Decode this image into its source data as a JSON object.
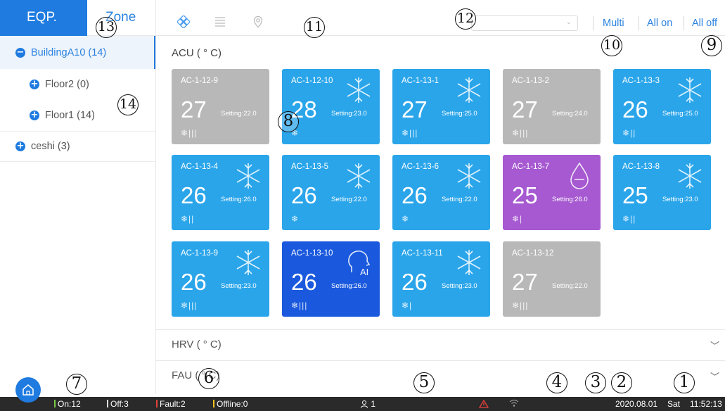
{
  "sidebar": {
    "tab_eqp": "EQP.",
    "tab_zone": "Zone",
    "tree": [
      {
        "label": "BuildingA10 (14)",
        "icon": "minus",
        "selected": true
      },
      {
        "label": "Floor2 (0)",
        "icon": "plus"
      },
      {
        "label": "Floor1 (14)",
        "icon": "plus"
      },
      {
        "label": "ceshi (3)",
        "icon": "plus"
      }
    ]
  },
  "toolbar": {
    "icons": [
      "grid-view-icon",
      "list-view-icon",
      "location-icon"
    ],
    "dropdown_value": "",
    "multi": "Multi",
    "all_on": "All on",
    "all_off": "All off"
  },
  "sections": {
    "acu": "ACU ( ° C)",
    "hrv": "HRV ( ° C)",
    "fau": "FAU ( ° C)"
  },
  "cards": [
    {
      "name": "AC-1-12-9",
      "temp": "27",
      "setting": "Setting:22.0",
      "fan": "❄|||",
      "color": "#b8b8b8",
      "mode": "none"
    },
    {
      "name": "AC-1-12-10",
      "temp": "28",
      "setting": "Setting:23.0",
      "fan": "❄",
      "color": "#2aa5ea",
      "mode": "snowflake"
    },
    {
      "name": "AC-1-13-1",
      "temp": "27",
      "setting": "Setting:25.0",
      "fan": "❄|||",
      "color": "#2aa5ea",
      "mode": "snowflake"
    },
    {
      "name": "AC-1-13-2",
      "temp": "27",
      "setting": "Setting:24.0",
      "fan": "❄|||",
      "color": "#b8b8b8",
      "mode": "none"
    },
    {
      "name": "AC-1-13-3",
      "temp": "26",
      "setting": "Setting:25.0",
      "fan": "❄||",
      "color": "#2aa5ea",
      "mode": "snowflake"
    },
    {
      "name": "AC-1-13-4",
      "temp": "26",
      "setting": "Setting:26.0",
      "fan": "❄||",
      "color": "#2aa5ea",
      "mode": "snowflake"
    },
    {
      "name": "AC-1-13-5",
      "temp": "26",
      "setting": "Setting:22.0",
      "fan": "❄",
      "color": "#2aa5ea",
      "mode": "snowflake"
    },
    {
      "name": "AC-1-13-6",
      "temp": "26",
      "setting": "Setting:22.0",
      "fan": "❄",
      "color": "#2aa5ea",
      "mode": "snowflake"
    },
    {
      "name": "AC-1-13-7",
      "temp": "25",
      "setting": "Setting:26.0",
      "fan": "❄|",
      "color": "#a659d0",
      "mode": "drop"
    },
    {
      "name": "AC-1-13-8",
      "temp": "25",
      "setting": "Setting:23.0",
      "fan": "❄||",
      "color": "#2aa5ea",
      "mode": "snowflake"
    },
    {
      "name": "AC-1-13-9",
      "temp": "26",
      "setting": "Setting:23.0",
      "fan": "❄|||",
      "color": "#2aa5ea",
      "mode": "snowflake"
    },
    {
      "name": "AC-1-13-10",
      "temp": "26",
      "setting": "Setting:26.0",
      "fan": "❄|||",
      "color": "#1a59dd",
      "mode": "ai"
    },
    {
      "name": "AC-1-13-11",
      "temp": "26",
      "setting": "Setting:23.0",
      "fan": "❄|",
      "color": "#2aa5ea",
      "mode": "snowflake"
    },
    {
      "name": "AC-1-13-12",
      "temp": "27",
      "setting": "Setting:22.0",
      "fan": "❄|||",
      "color": "#b8b8b8",
      "mode": "none"
    }
  ],
  "statusbar": {
    "on": "On:12",
    "off": "Off:3",
    "fault": "Fault:2",
    "offline": "Offline:0",
    "users": "1",
    "date": "2020.08.01",
    "weekday": "Sat",
    "time": "11:52:13",
    "colors": {
      "on": "#7ac943",
      "off": "#e0e0e0",
      "fault": "#e8403a",
      "offline": "#f5c518"
    }
  },
  "annotations": [
    "1",
    "2",
    "3",
    "4",
    "5",
    "6",
    "7",
    "8",
    "9",
    "10",
    "11",
    "12",
    "13",
    "14"
  ]
}
